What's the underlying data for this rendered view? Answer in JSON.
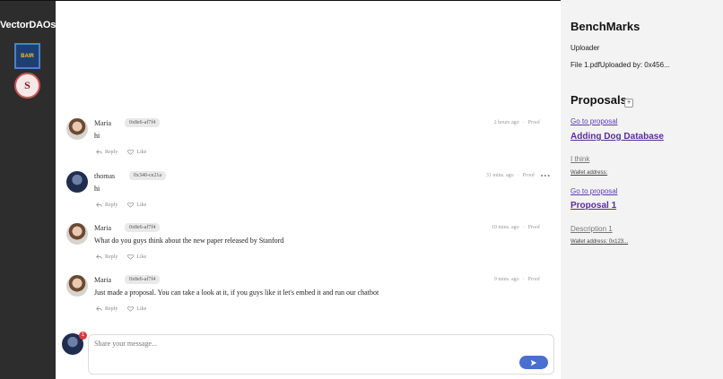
{
  "sidebar": {
    "brand": "VectorDAOs",
    "logos": [
      {
        "name": "bair-logo",
        "text": "BAIR"
      },
      {
        "name": "stanford-logo",
        "text": "S"
      }
    ]
  },
  "messages": [
    {
      "name": "Maria",
      "address": "0x8e6-af7f4",
      "text": "hi",
      "time": "2 hours ago",
      "proof": "Proof",
      "reply": "Reply",
      "like": "Like",
      "avatar": "maria"
    },
    {
      "name": "thomas",
      "address": "0x340-ce21a",
      "text": "hi",
      "time": "31 mins. ago",
      "proof": "Proof",
      "reply": "Reply",
      "like": "Like",
      "avatar": "thomas",
      "more": "•••"
    },
    {
      "name": "Maria",
      "address": "0x8e6-af7f4",
      "text": "What do you guys think about the new paper released by Stanford",
      "time": "10 mins. ago",
      "proof": "Proof",
      "reply": "Reply",
      "like": "Like",
      "avatar": "maria"
    },
    {
      "name": "Maria",
      "address": "0x8e6-af7f4",
      "text": "Just made a proposal. You can take a look at it, if you guys like it let's embed it and run our chatbot",
      "time": "9 mins. ago",
      "proof": "Proof",
      "reply": "Reply",
      "like": "Like",
      "avatar": "maria"
    }
  ],
  "compose": {
    "placeholder": "Share your message...",
    "notification_count": "1"
  },
  "panel": {
    "benchmarks_title": "BenchMarks",
    "uploader_label": "Uploader",
    "file_line": "File 1.pdfUploaded by: 0x456...",
    "proposals_title": "Proposals",
    "add_label": "+",
    "proposals": [
      {
        "link": "Go to proposal",
        "title": "Adding Dog Database",
        "description": "I think",
        "wallet": "Wallet address:"
      },
      {
        "link": "Go to proposal",
        "title": "Proposal 1",
        "description": "Description 1",
        "wallet": "Wallet address: 0x123..."
      }
    ]
  },
  "colors": {
    "sidebar_bg": "#2d2d2d",
    "panel_bg": "#f3f3f3",
    "accent": "#5b2d9a",
    "send_button": "#4a6fcf",
    "notification": "#e0393e"
  }
}
